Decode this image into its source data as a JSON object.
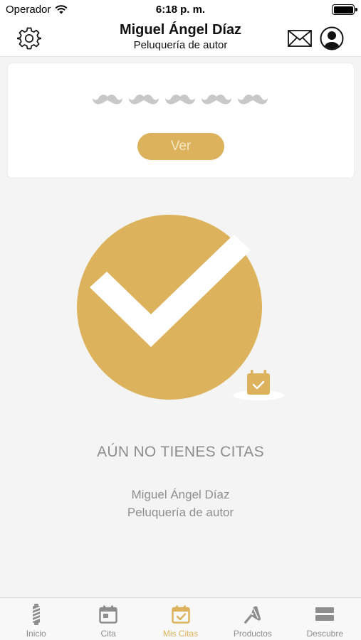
{
  "status_bar": {
    "carrier": "Operador",
    "time": "6:18 p. m."
  },
  "header": {
    "title": "Miguel Ángel Díaz",
    "subtitle": "Peluquería de autor",
    "left_icon": "gear-icon",
    "right_icons": [
      "envelope-icon",
      "user-profile-icon"
    ]
  },
  "rating_card": {
    "rating": 0,
    "max_rating": 5,
    "icon": "mustache-icon",
    "button_label": "Ver"
  },
  "empty_state": {
    "icon": "checkmark-circle-icon",
    "badge_icon": "calendar-check-icon",
    "title": "AÚN NO TIENES CITAS",
    "name": "Miguel Ángel Díaz",
    "subtitle": "Peluquería de autor"
  },
  "tabs": [
    {
      "label": "Inicio",
      "icon": "barber-pole-icon",
      "active": false
    },
    {
      "label": "Cita",
      "icon": "calendar-icon",
      "active": false
    },
    {
      "label": "Mis Citas",
      "icon": "calendar-check-icon",
      "active": true
    },
    {
      "label": "Productos",
      "icon": "razor-icon",
      "active": false
    },
    {
      "label": "Descubre",
      "icon": "menu-bars-icon",
      "active": false
    }
  ],
  "colors": {
    "accent": "#dcb35c",
    "inactive": "#8e8e8e",
    "mustache_empty": "#c8c8c8",
    "background": "#f4f4f4"
  }
}
